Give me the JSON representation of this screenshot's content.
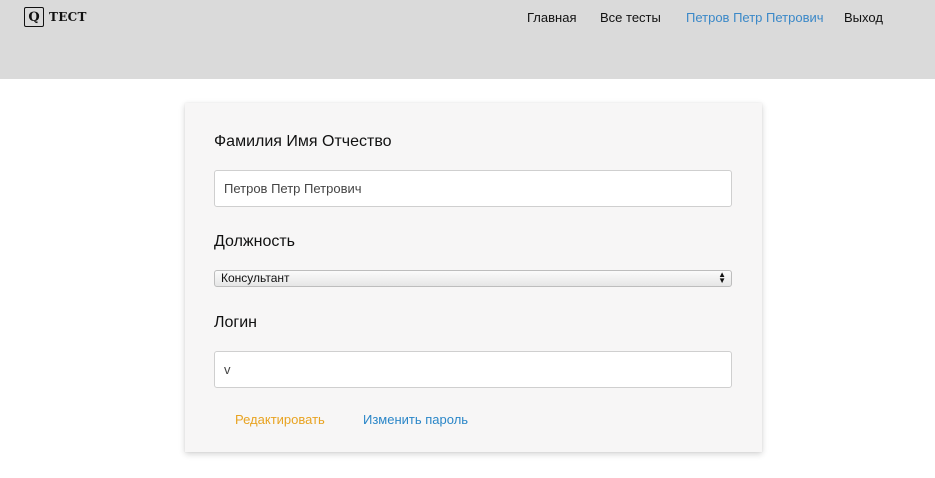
{
  "header": {
    "logo_letter": "Q",
    "logo_text": "ТЕСТ",
    "nav": {
      "home": "Главная",
      "all_tests": "Все тесты",
      "user": "Петров Петр Петрович",
      "logout": "Выход"
    }
  },
  "form": {
    "fio_label": "Фамилия Имя Отчество",
    "fio_value": "Петров Петр Петрович",
    "position_label": "Должность",
    "position_selected": "Консультант",
    "login_label": "Логин",
    "login_value": "v",
    "edit_button": "Редактировать",
    "change_password_button": "Изменить пароль"
  },
  "colors": {
    "header_bg": "#dadada",
    "user_link": "#3a88c8",
    "edit_button": "#e8a321",
    "change_password_button": "#2a86c8"
  }
}
